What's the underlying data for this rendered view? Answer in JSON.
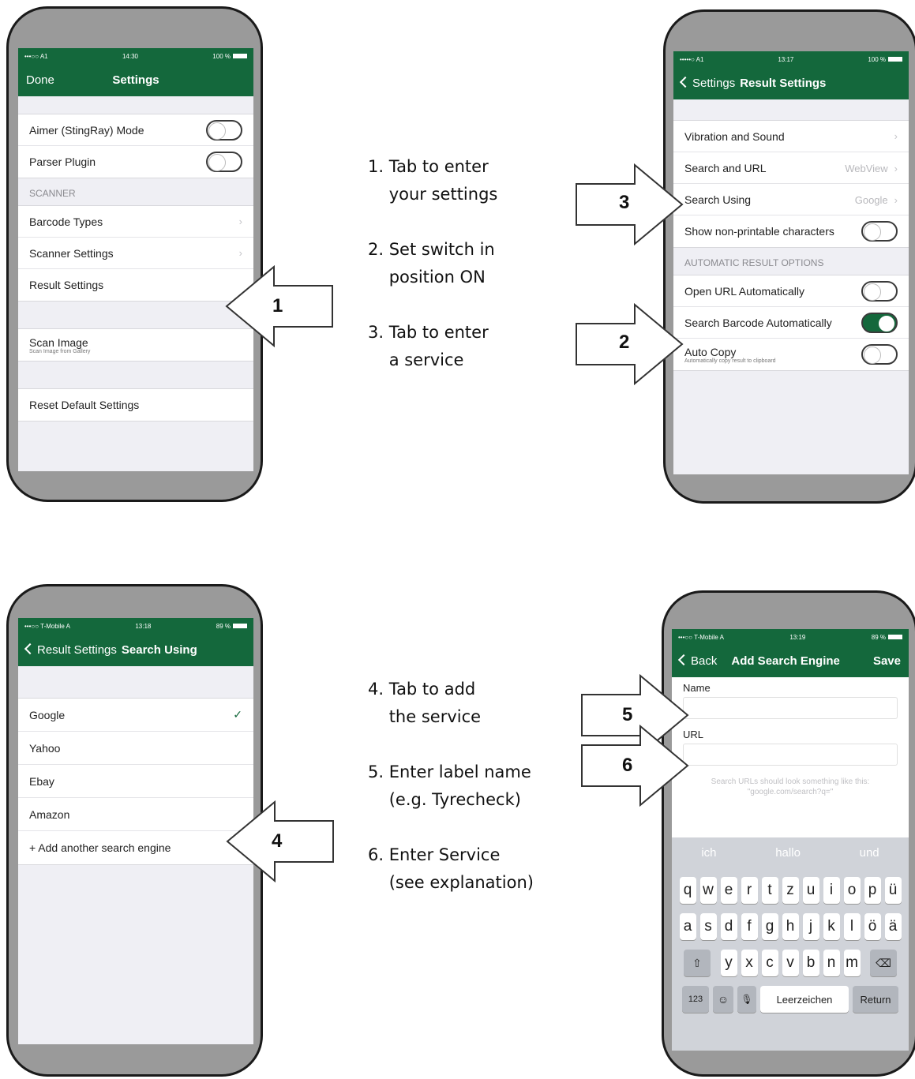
{
  "phone1": {
    "status": {
      "carrier": "•••○○ A1",
      "time": "14:30",
      "battery": "100 %"
    },
    "nav": {
      "left": "Done",
      "title": "Settings"
    },
    "rows_top": [
      {
        "label": "Aimer (StingRay) Mode"
      },
      {
        "label": "Parser Plugin"
      }
    ],
    "section": "SCANNER",
    "rows_scanner": [
      {
        "label": "Barcode Types"
      },
      {
        "label": "Scanner Settings"
      },
      {
        "label": "Result Settings"
      }
    ],
    "scan_image": {
      "label": "Scan Image",
      "sub": "Scan Image from Gallery"
    },
    "reset": {
      "label": "Reset Default Settings"
    }
  },
  "phone2": {
    "status": {
      "carrier": "•••••○ A1",
      "time": "13:17",
      "battery": "100 %"
    },
    "nav": {
      "back": "Settings",
      "title": "Result Settings"
    },
    "rows": [
      {
        "label": "Vibration and Sound",
        "value": ""
      },
      {
        "label": "Search and URL",
        "value": "WebView"
      },
      {
        "label": "Search Using",
        "value": "Google"
      },
      {
        "label": "Show non-printable characters"
      }
    ],
    "section": "AUTOMATIC RESULT OPTIONS",
    "auto_rows": [
      {
        "label": "Open URL Automatically"
      },
      {
        "label": "Search Barcode Automatically"
      },
      {
        "label": "Auto Copy",
        "sub": "Automatically copy result to clipboard"
      }
    ]
  },
  "phone3": {
    "status": {
      "carrier": "•••○○ T-Mobile A",
      "time": "13:18",
      "battery": "89 %"
    },
    "nav": {
      "back": "Result Settings",
      "title": "Search Using"
    },
    "rows": [
      {
        "label": "Google",
        "check": "✓"
      },
      {
        "label": "Yahoo"
      },
      {
        "label": "Ebay"
      },
      {
        "label": "Amazon"
      },
      {
        "label": "+ Add another search engine"
      }
    ]
  },
  "phone4": {
    "status": {
      "carrier": "•••○○ T-Mobile A",
      "time": "13:19",
      "battery": "89 %"
    },
    "nav": {
      "back": "Back",
      "title": "Add Search Engine",
      "right": "Save"
    },
    "name_label": "Name",
    "url_label": "URL",
    "hint": "Search URLs should look something like this: \"google.com/search?q=\"",
    "suggestions": [
      "ich",
      "hallo",
      "und"
    ],
    "keys_row1": [
      "q",
      "w",
      "e",
      "r",
      "t",
      "z",
      "u",
      "i",
      "o",
      "p",
      "ü"
    ],
    "keys_row2": [
      "a",
      "s",
      "d",
      "f",
      "g",
      "h",
      "j",
      "k",
      "l",
      "ö",
      "ä"
    ],
    "keys_row3": [
      "y",
      "x",
      "c",
      "v",
      "b",
      "n",
      "m"
    ],
    "shift": "⇧",
    "delete": "⌫",
    "num": "123",
    "emoji": "☺",
    "mic": "🎙",
    "space": "Leerzeichen",
    "return": "Return"
  },
  "instructions_top": "1. Tab to enter\n    your settings\n\n2. Set switch in\n    position ON\n\n3. Tab to enter\n    a service",
  "instructions_bottom": "4. Tab to add\n    the service\n\n5. Enter label name\n    (e.g. Tyrecheck)\n\n6. Enter Service\n    (see explanation)",
  "arrows": {
    "a1": "1",
    "a2": "2",
    "a3": "3",
    "a4": "4",
    "a5": "5",
    "a6": "6"
  }
}
